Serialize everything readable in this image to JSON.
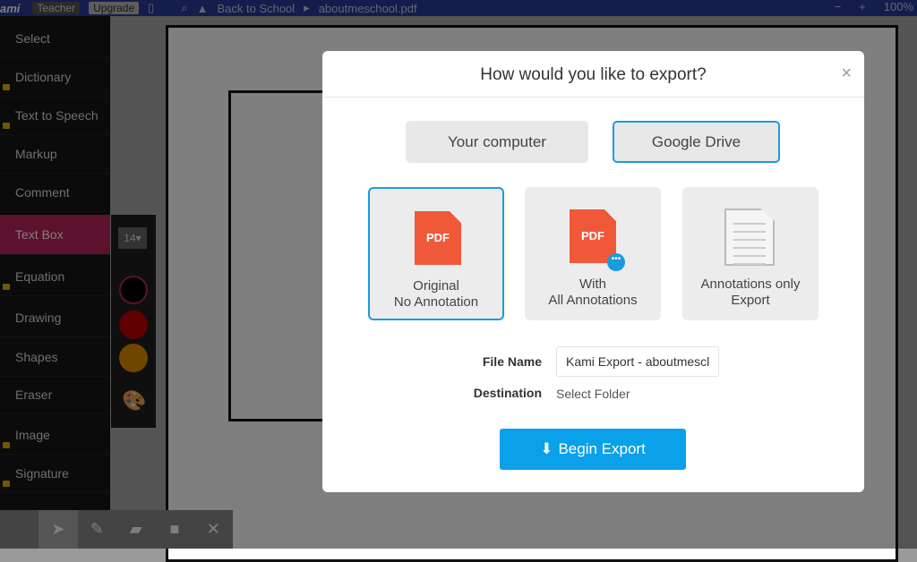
{
  "topbar": {
    "logo": "ami",
    "teacher": "Teacher",
    "upgrade": "Upgrade",
    "folder": "Back to School",
    "file": "aboutmeschool.pdf",
    "zoom_out": "−",
    "zoom_in": "+",
    "zoom": "100%"
  },
  "sidebar": {
    "items": [
      {
        "label": "Select"
      },
      {
        "label": "Dictionary",
        "locked": true
      },
      {
        "label": "Text to Speech",
        "locked": true
      },
      {
        "label": "Markup"
      },
      {
        "label": "Comment"
      },
      {
        "label": "Text Box",
        "active": true
      },
      {
        "label": "Equation",
        "locked": true
      },
      {
        "label": "Drawing"
      },
      {
        "label": "Shapes"
      },
      {
        "label": "Eraser"
      },
      {
        "label": "Image",
        "locked": true
      },
      {
        "label": "Signature",
        "locked": true
      }
    ]
  },
  "color_panel": {
    "font_size": "14",
    "colors": [
      "#000000",
      "#c00000",
      "#e08a00"
    ]
  },
  "modal": {
    "title": "How would you like to export?",
    "close": "×",
    "destinations": [
      "Your computer",
      "Google Drive"
    ],
    "selected_destination": "Google Drive",
    "options": [
      {
        "line1": "Original",
        "line2": "No Annotation",
        "icon": "PDF",
        "selected": true
      },
      {
        "line1": "With",
        "line2": "All Annotations",
        "icon": "PDF"
      },
      {
        "line1": "Annotations only",
        "line2": "Export",
        "icon": "text-document"
      }
    ],
    "file_name_label": "File Name",
    "file_name_value": "Kami Export - aboutmescl",
    "destination_label": "Destination",
    "destination_value": "Select Folder",
    "begin": "Begin Export",
    "accent": "#0aa0ea"
  }
}
